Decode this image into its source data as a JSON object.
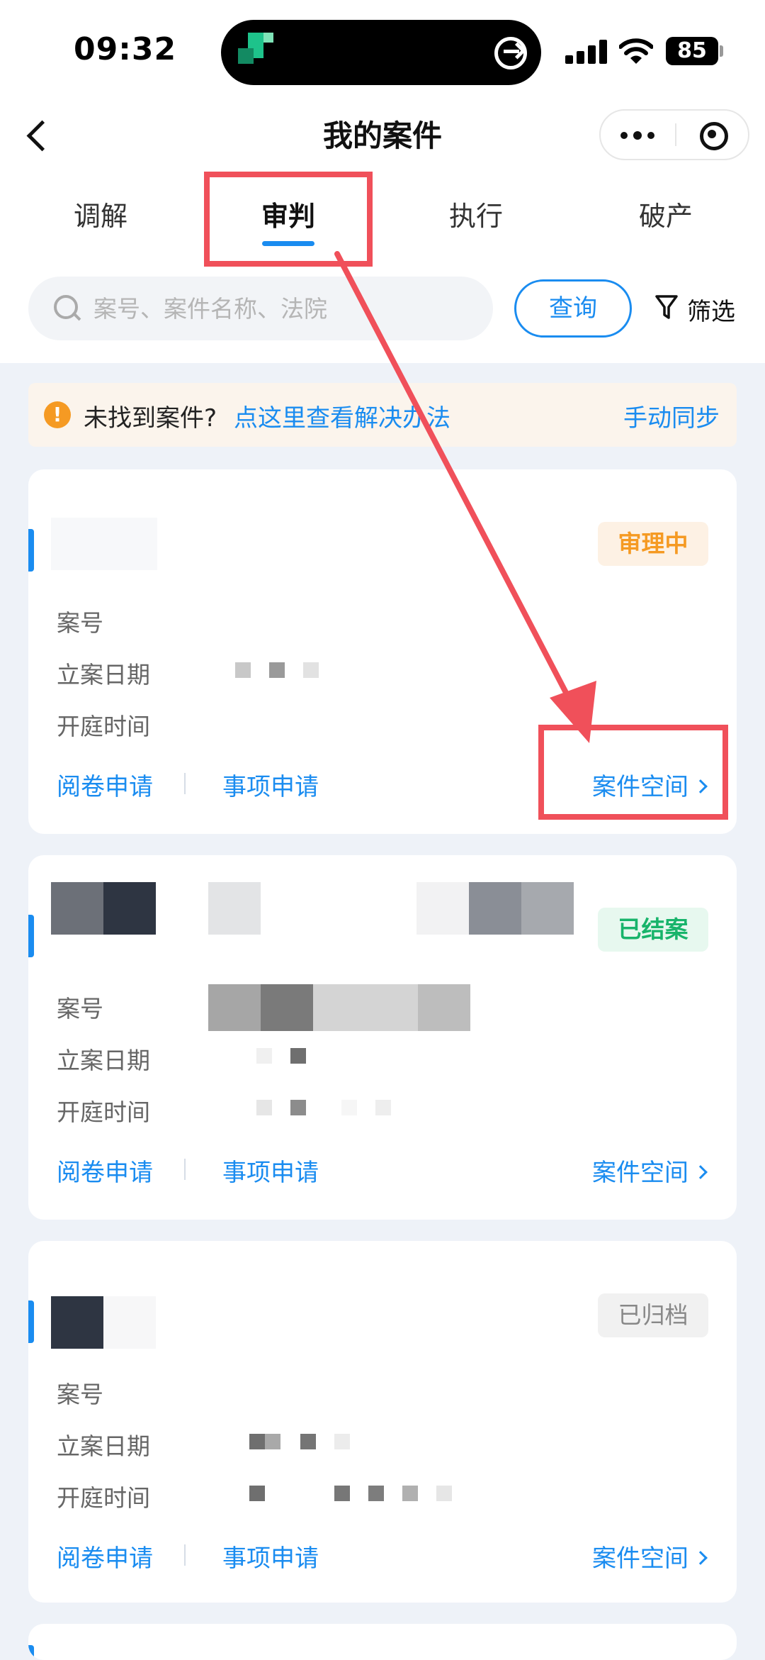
{
  "status_bar": {
    "time": "09:32",
    "battery": "85"
  },
  "nav": {
    "title": "我的案件"
  },
  "tabs": [
    {
      "label": "调解",
      "active": false
    },
    {
      "label": "审判",
      "active": true
    },
    {
      "label": "执行",
      "active": false
    },
    {
      "label": "破产",
      "active": false
    }
  ],
  "search": {
    "placeholder": "案号、案件名称、法院",
    "query_label": "查询",
    "filter_label": "筛选"
  },
  "notice": {
    "text": "未找到案件?",
    "link": "点这里查看解决办法",
    "sync": "手动同步"
  },
  "case_fields": {
    "case_no": "案号",
    "filing_date": "立案日期",
    "hearing_time": "开庭时间"
  },
  "card_actions": {
    "review": "阅卷申请",
    "matter": "事项申请",
    "space": "案件空间"
  },
  "cards": [
    {
      "status": "审理中",
      "status_color": "#f59a23"
    },
    {
      "status": "已结案",
      "status_color": "#18b46b"
    },
    {
      "status": "已归档",
      "status_color": "#888888"
    }
  ],
  "colors": {
    "accent": "#1a8cf0",
    "annotation": "#f0505a"
  }
}
